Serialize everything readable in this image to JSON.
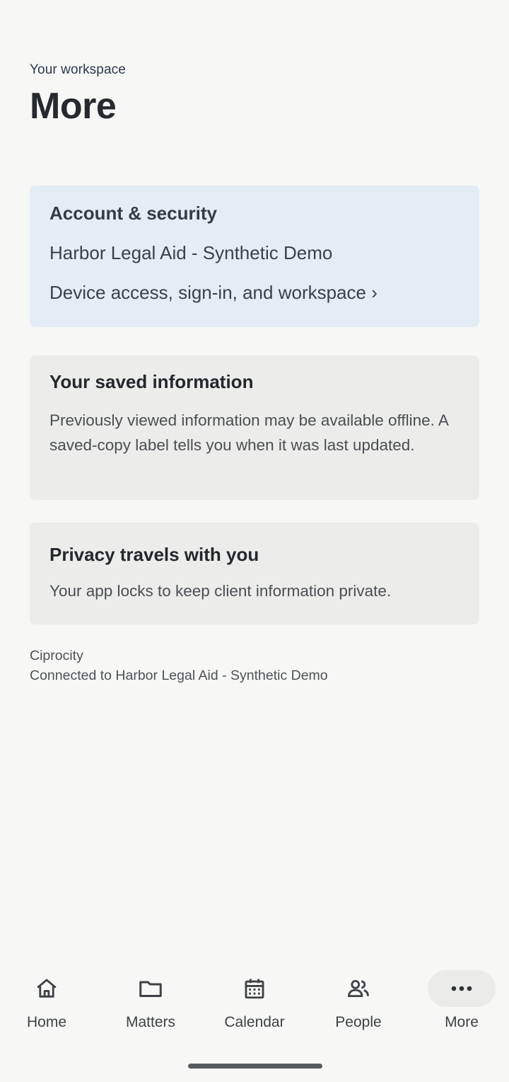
{
  "header": {
    "eyebrow": "Your workspace",
    "title": "More"
  },
  "account_card": {
    "title": "Account & security",
    "workspace_name": "Harbor Legal Aid - Synthetic Demo",
    "link_text": "Device access, sign-in, and workspace ›"
  },
  "saved_card": {
    "title": "Your saved information",
    "body": "Previously viewed information may be available offline. A saved-copy label tells you when it was last updated."
  },
  "privacy_card": {
    "title": "Privacy travels with you",
    "body": "Your app locks to keep client information private."
  },
  "footer": {
    "app_name": "Ciprocity",
    "connection": "Connected to Harbor Legal Aid - Synthetic Demo"
  },
  "tabs": [
    {
      "label": "Home",
      "icon": "home-icon",
      "active": false
    },
    {
      "label": "Matters",
      "icon": "folder-icon",
      "active": false
    },
    {
      "label": "Calendar",
      "icon": "calendar-icon",
      "active": false
    },
    {
      "label": "People",
      "icon": "people-icon",
      "active": false
    },
    {
      "label": "More",
      "icon": "more-icon",
      "active": true
    }
  ],
  "colors": {
    "background": "#f7f7f5",
    "account_card": "#e4ecf5",
    "card": "#ececea",
    "text_primary": "#23282d"
  }
}
